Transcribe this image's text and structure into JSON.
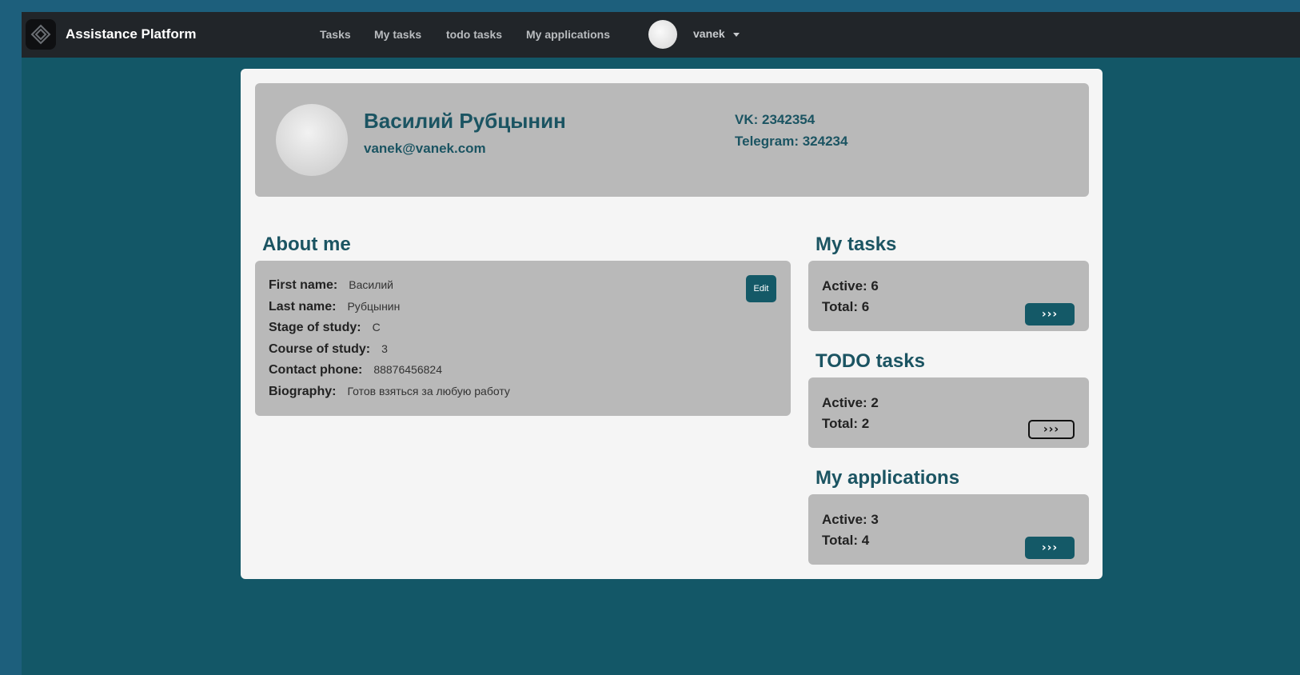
{
  "navbar": {
    "brand": "Assistance Platform",
    "links": [
      "Tasks",
      "My tasks",
      "todo tasks",
      "My applications"
    ],
    "user": "vanek"
  },
  "profile": {
    "name": "Василий Рубцынин",
    "email": "vanek@vanek.com",
    "vk": "VK: 2342354",
    "telegram": "Telegram: 324234"
  },
  "about": {
    "title": "About me",
    "edit_label": "Edit",
    "rows": [
      {
        "label": "First name:",
        "value": "Василий"
      },
      {
        "label": "Last name:",
        "value": "Рубцынин"
      },
      {
        "label": "Stage of study:",
        "value": "С"
      },
      {
        "label": "Course of study:",
        "value": "3"
      },
      {
        "label": "Contact phone:",
        "value": "88876456824"
      },
      {
        "label": "Biography:",
        "value": "Готов взяться за любую работу"
      }
    ]
  },
  "stats": [
    {
      "title": "My tasks",
      "active": "Active: 6",
      "total": "Total: 6",
      "button": "›››"
    },
    {
      "title": "TODO tasks",
      "active": "Active: 2",
      "total": "Total: 2",
      "button": "›››"
    },
    {
      "title": "My applications",
      "active": "Active: 3",
      "total": "Total: 4",
      "button": "›››"
    }
  ],
  "colors": {
    "accent": "#145967",
    "navbar": "#212529",
    "background": "#135767",
    "panel": "#b9b9b9"
  }
}
